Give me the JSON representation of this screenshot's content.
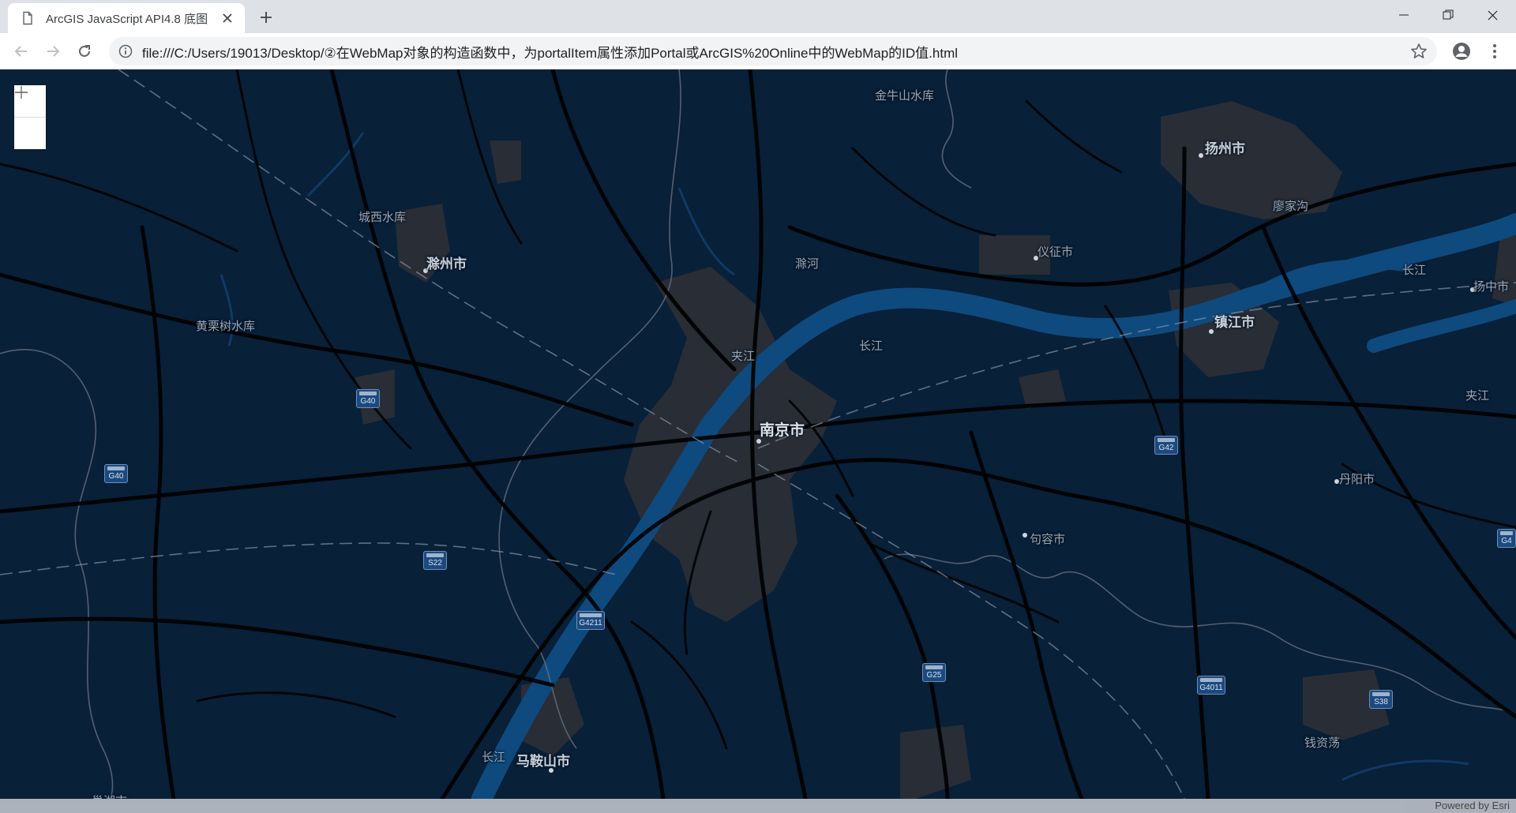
{
  "browser": {
    "tab_title": "ArcGIS JavaScript API4.8 底图",
    "url": "file:///C:/Users/19013/Desktop/②在WebMap对象的构造函数中，为portalItem属性添加Portal或ArcGIS%20Online中的WebMap的ID值.html"
  },
  "map": {
    "zoom_in": "+",
    "zoom_out": "—",
    "attribution": "Powered by Esri",
    "labels": {
      "jinniushan": "金牛山水库",
      "yangzhou": "扬州市",
      "chengxi": "城西水库",
      "chuzhou": "滁州市",
      "liaojiagou": "廖家沟",
      "chuhe": "滁河",
      "yizheng": "仪征市",
      "changjiang_e": "长江",
      "yangzhong": "扬中市",
      "huangliashu": "黄栗树水库",
      "zhenjiang": "镇江市",
      "jiajiang": "夹江",
      "changjiang_c": "长江",
      "nanjing": "南京市",
      "jiajiang_e": "夹江",
      "danyang": "丹阳市",
      "jurong": "句容市",
      "qianzidang": "钱资荡",
      "changjiang_s": "长江",
      "maanshan": "马鞍山市",
      "chaohu": "巢湖市"
    },
    "shields": {
      "g40a": "G40",
      "g40b": "G40",
      "g42": "G42",
      "s22": "S22",
      "g4211": "G4211",
      "g25": "G25",
      "g4011": "G4011",
      "s38": "S38",
      "g4": "G4"
    }
  }
}
